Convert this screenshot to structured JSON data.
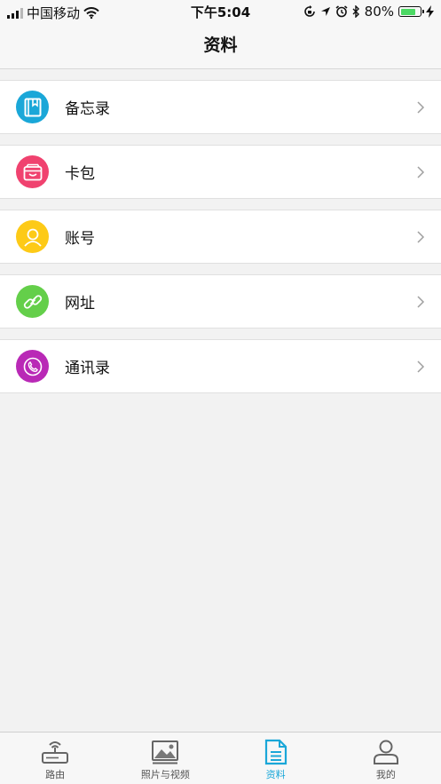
{
  "status_bar": {
    "carrier": "中国移动",
    "time": "下午5:04",
    "battery_percent": "80%",
    "battery_level": 0.8
  },
  "nav": {
    "title": "资料"
  },
  "items": [
    {
      "label": "备忘录",
      "icon": "book-icon",
      "color": "#1aa7d8"
    },
    {
      "label": "卡包",
      "icon": "wallet-icon",
      "color": "#f0426f"
    },
    {
      "label": "账号",
      "icon": "person-icon",
      "color": "#fdca17"
    },
    {
      "label": "网址",
      "icon": "link-icon",
      "color": "#64cf4a"
    },
    {
      "label": "通讯录",
      "icon": "phone-icon",
      "color": "#b929b6"
    }
  ],
  "tabs": [
    {
      "label": "路由",
      "icon": "router-icon",
      "active": false
    },
    {
      "label": "照片与视频",
      "icon": "photo-icon",
      "active": false
    },
    {
      "label": "资料",
      "icon": "document-icon",
      "active": true
    },
    {
      "label": "我的",
      "icon": "profile-icon",
      "active": false
    }
  ],
  "colors": {
    "accent": "#1aa7d8",
    "tab_inactive": "#555555"
  }
}
